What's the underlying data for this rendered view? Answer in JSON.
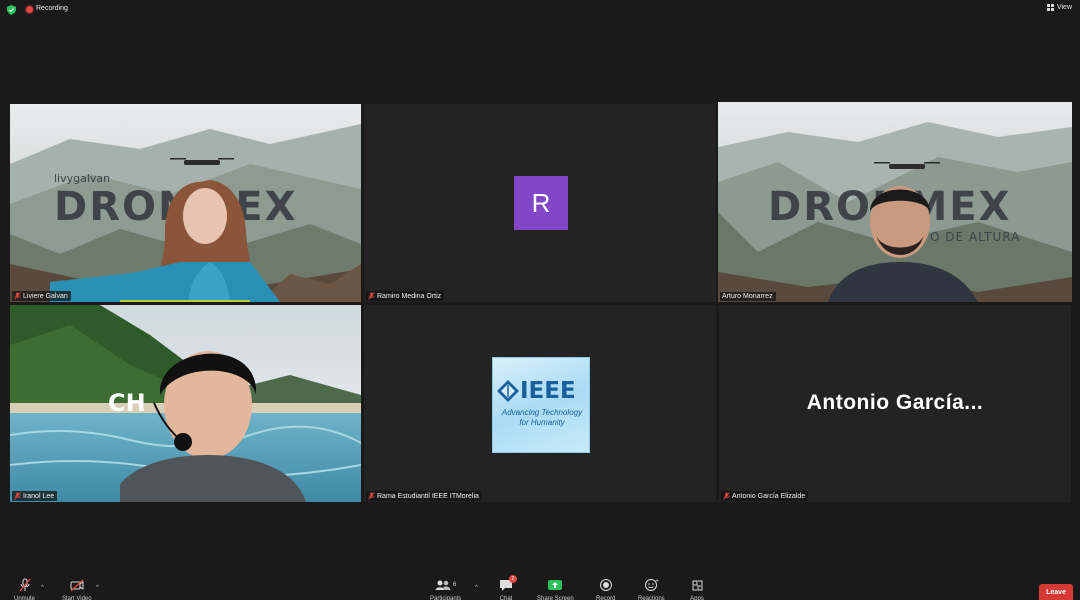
{
  "topbar": {
    "recording_label": "Recording",
    "view_label": "View"
  },
  "tiles": [
    {
      "name": "Liviere Galvan",
      "brand_text": "DRONMEX",
      "brand_handle": "livygalvan"
    },
    {
      "name": "Ramiro Medina Ortiz",
      "avatar_letter": "R"
    },
    {
      "name": "Arturo Monarrez",
      "brand_text": "DRONMEX",
      "brand_sub": "O DE ALTURA"
    },
    {
      "name": "Iranol Lee",
      "bg_text": "CH"
    },
    {
      "name": "Rama Estudiantil IEEE ITMorelia",
      "logo_text": "IEEE",
      "logo_line1": "Advancing Technology",
      "logo_line2": "for Humanity"
    },
    {
      "name": "Antonio García Elizalde",
      "display_name": "Antonio  García..."
    }
  ],
  "toolbar": {
    "unmute_label": "Unmute",
    "start_video_label": "Start Video",
    "participants_label": "Participants",
    "participants_count": "6",
    "chat_label": "Chat",
    "chat_badge": "2",
    "share_screen_label": "Share Screen",
    "record_label": "Record",
    "reactions_label": "Reactions",
    "apps_label": "Apps",
    "leave_label": "Leave"
  },
  "colors": {
    "active_speaker": "#b6d23a",
    "avatar_purple": "#8147c7",
    "leave_red": "#d63a35",
    "share_green": "#2dbf5b"
  }
}
